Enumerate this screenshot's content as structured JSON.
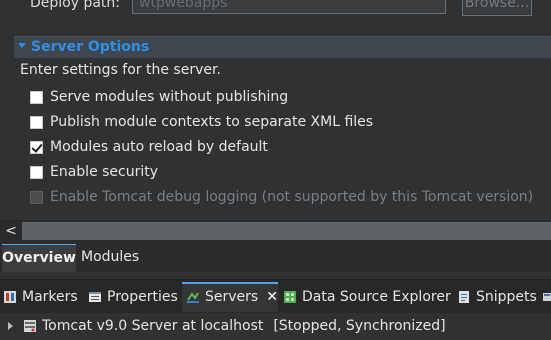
{
  "deploy": {
    "label": "Deploy path:",
    "value": "wtpwebapps",
    "browse_label": "Browse..."
  },
  "server_options": {
    "title": "Server Options",
    "description": "Enter settings for the server.",
    "options": [
      {
        "label": "Serve modules without publishing",
        "checked": false,
        "enabled": true
      },
      {
        "label": "Publish module contexts to separate XML files",
        "checked": false,
        "enabled": true
      },
      {
        "label": "Modules auto reload by default",
        "checked": true,
        "enabled": true
      },
      {
        "label": "Enable security",
        "checked": false,
        "enabled": true
      },
      {
        "label": "Enable Tomcat debug logging (not supported by this Tomcat version)",
        "checked": false,
        "enabled": false
      }
    ]
  },
  "scrollbar": {
    "left_arrow": "<"
  },
  "editor_tabs": [
    {
      "label": "Overview",
      "active": true
    },
    {
      "label": "Modules",
      "active": false
    }
  ],
  "views": [
    {
      "label": "Markers",
      "icon": "markers-icon"
    },
    {
      "label": "Properties",
      "icon": "properties-icon"
    },
    {
      "label": "Servers",
      "icon": "servers-icon",
      "active": true,
      "close": "✕"
    },
    {
      "label": "Data Source Explorer",
      "icon": "data-source-explorer-icon"
    },
    {
      "label": "Snippets",
      "icon": "snippets-icon"
    }
  ],
  "servers": [
    {
      "name": "Tomcat v9.0 Server at localhost",
      "status": "[Stopped, Synchronized]"
    }
  ],
  "colors": {
    "accent": "#2f8fe6",
    "background": "#2f3133",
    "text": "#e6e6e6"
  }
}
